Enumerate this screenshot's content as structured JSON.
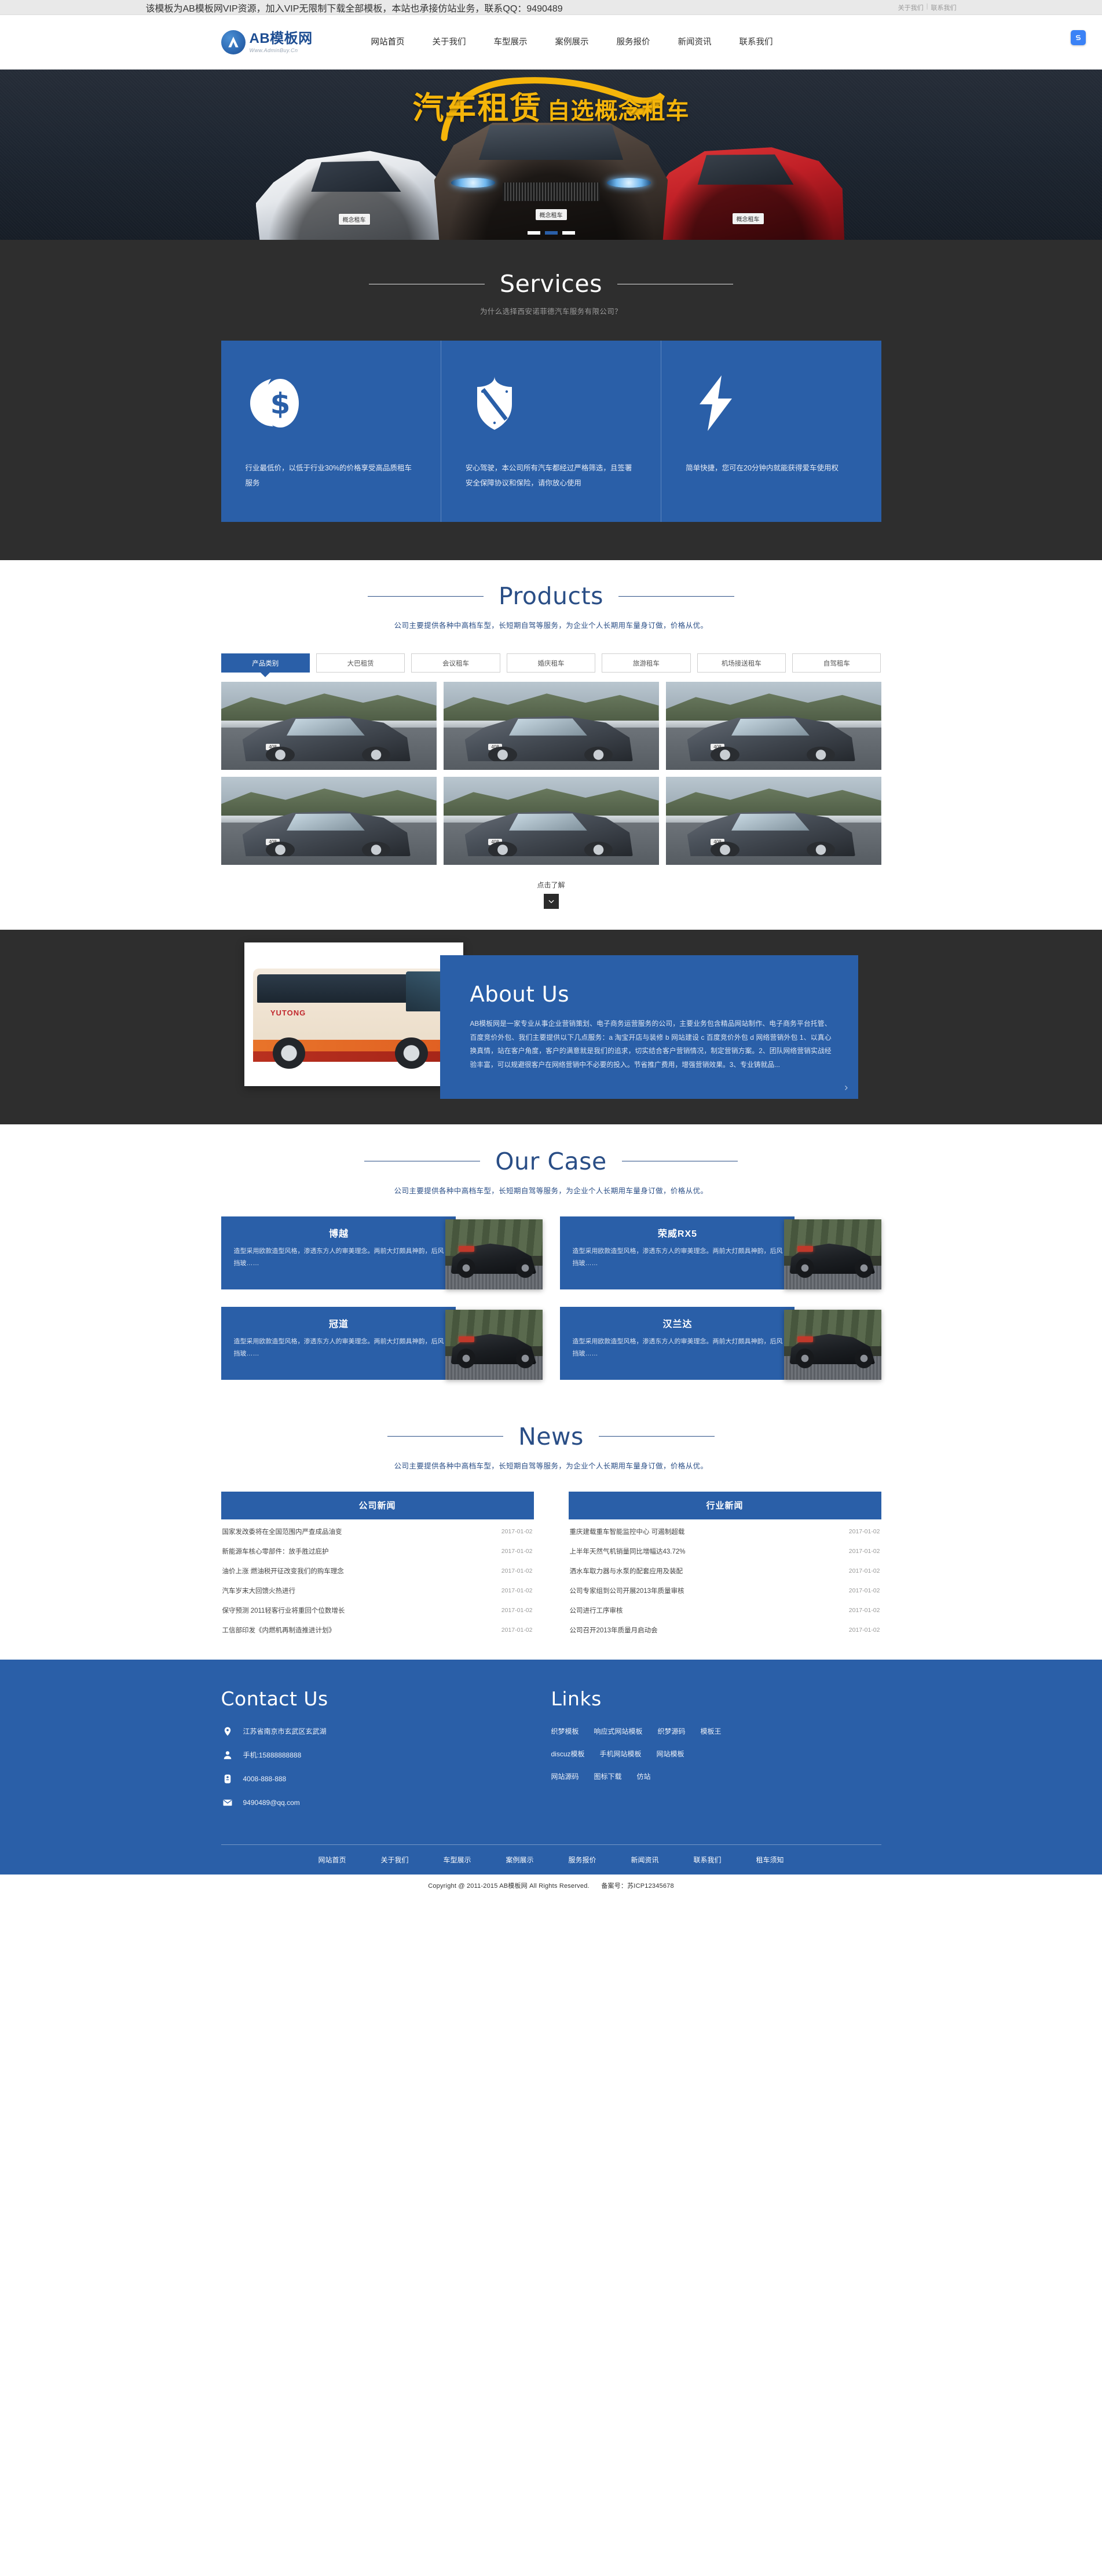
{
  "topbar": {
    "notice": "该模板为AB模板网VIP资源，加入VIP无限制下载全部模板，本站也承接仿站业务，联系QQ：9490489",
    "link_about": "关于我们",
    "separator": "|",
    "link_contact": "联系我们"
  },
  "header": {
    "logo_cn": "AB模板网",
    "logo_url": "Www.AdminBuy.Cn",
    "nav": [
      {
        "label": "网站首页"
      },
      {
        "label": "关于我们"
      },
      {
        "label": "车型展示"
      },
      {
        "label": "案例展示"
      },
      {
        "label": "服务报价"
      },
      {
        "label": "新闻资讯"
      },
      {
        "label": "联系我们"
      }
    ]
  },
  "hero": {
    "title_main": "汽车租赁",
    "title_sub": "自选概念租车",
    "plate": "概念租车",
    "slide_count": 3,
    "active_slide": 2
  },
  "services": {
    "title": "Services",
    "subtitle": "为什么选择西安诺菲德汽车服务有限公司？",
    "cards": [
      {
        "icon": "dollar-coin-icon",
        "text": "行业最低价，以低于行业30%的价格享受高品质租车服务"
      },
      {
        "icon": "shield-icon",
        "text": "安心驾驶，本公司所有汽车都经过严格筛选，且签署安全保障协议和保险，请你放心使用"
      },
      {
        "icon": "lightning-icon",
        "text": "简单快捷，您可在20分钟内就能获得爱车使用权"
      }
    ]
  },
  "products": {
    "title": "Products",
    "subtitle": "公司主要提供各种中高档车型，长短期自驾等服务，为企业个人长期用车量身订做，价格从优。",
    "tabs": [
      {
        "label": "产品类别",
        "active": true
      },
      {
        "label": "大巴租赁",
        "active": false
      },
      {
        "label": "会议租车",
        "active": false
      },
      {
        "label": "婚庆租车",
        "active": false
      },
      {
        "label": "旅游租车",
        "active": false
      },
      {
        "label": "机场接送租车",
        "active": false
      },
      {
        "label": "自驾租车",
        "active": false
      }
    ],
    "items": [
      {
        "plate": "408"
      },
      {
        "plate": "408"
      },
      {
        "plate": "408"
      },
      {
        "plate": "408"
      },
      {
        "plate": "408"
      },
      {
        "plate": "408"
      }
    ],
    "more_label": "点击了解",
    "more_icon": "chevron-down-icon"
  },
  "about": {
    "title": "About Us",
    "image_label": "YUTONG",
    "text": "AB模板网是一家专业从事企业营销策划、电子商务运营服务的公司，主要业务包含精品网站制作、电子商务平台托管、百度竞价外包、我们主要提供以下几点服务：a 淘宝开店与装修 b 网站建设 c 百度竞价外包 d 网络营销外包 1、以真心换真情，站在客户角度，客户的满意就是我们的追求，切实结合客户营销情况，制定营销方案。2、团队网络营销实战经验丰富，可以规避很客户在网络营销中不必要的投入。节省推广费用，增强营销效果。3、专业铸就品...",
    "next_icon": "chevron-right-icon"
  },
  "cases": {
    "title": "Our Case",
    "subtitle": "公司主要提供各种中高档车型，长短期自驾等服务，为企业个人长期用车量身订做，价格从优。",
    "items": [
      {
        "name": "博越",
        "desc": "造型采用欧款造型风格，渗透东方人的审美理念。两前大灯颇具神韵，后风挡玻……"
      },
      {
        "name": "荣威RX5",
        "desc": "造型采用欧款造型风格，渗透东方人的审美理念。两前大灯颇具神韵，后风挡玻……"
      },
      {
        "name": "冠道",
        "desc": "造型采用欧款造型风格，渗透东方人的审美理念。两前大灯颇具神韵，后风挡玻……"
      },
      {
        "name": "汉兰达",
        "desc": "造型采用欧款造型风格，渗透东方人的审美理念。两前大灯颇具神韵，后风挡玻……"
      }
    ]
  },
  "news": {
    "title": "News",
    "subtitle": "公司主要提供各种中高档车型，长短期自驾等服务，为企业个人长期用车量身订做，价格从优。",
    "columns": [
      {
        "heading": "公司新闻",
        "items": [
          {
            "title": "国家发改委将在全国范围内严查成品油变",
            "date": "2017-01-02"
          },
          {
            "title": "新能源车核心零部件：放手胜过庇护",
            "date": "2017-01-02"
          },
          {
            "title": "油价上涨 燃油税开征改变我们的购车理念",
            "date": "2017-01-02"
          },
          {
            "title": "汽车岁末大回馈火热进行",
            "date": "2017-01-02"
          },
          {
            "title": "保守预测 2011轻客行业将重回个位数增长",
            "date": "2017-01-02"
          },
          {
            "title": "工信部印发《内燃机再制造推进计划》",
            "date": "2017-01-02"
          }
        ]
      },
      {
        "heading": "行业新闻",
        "items": [
          {
            "title": "重庆建载重车智能监控中心 可遏制超载",
            "date": "2017-01-02"
          },
          {
            "title": "上半年天然气机销量同比增幅达43.72%",
            "date": "2017-01-02"
          },
          {
            "title": "洒水车取力器与水泵的配套应用及装配",
            "date": "2017-01-02"
          },
          {
            "title": "公司专家组到公司开展2013年质量审核",
            "date": "2017-01-02"
          },
          {
            "title": "公司进行工序审核",
            "date": "2017-01-02"
          },
          {
            "title": "公司召开2013年质量月启动会",
            "date": "2017-01-02"
          }
        ]
      }
    ]
  },
  "footer": {
    "contact_title": "Contact Us",
    "contact_items": [
      {
        "icon": "location-pin-icon",
        "value": "江苏省南京市玄武区玄武湖"
      },
      {
        "icon": "person-icon",
        "value": "手机:15888888888"
      },
      {
        "icon": "telephone-icon",
        "value": "4008-888-888"
      },
      {
        "icon": "envelope-icon",
        "value": "9490489@qq.com"
      }
    ],
    "links_title": "Links",
    "links_rows": [
      [
        "织梦模板",
        "响应式网站模板",
        "织梦源码",
        "模板王"
      ],
      [
        "discuz模板",
        "手机网站模板",
        "网站模板"
      ],
      [
        "网站源码",
        "图标下载",
        "仿站"
      ]
    ],
    "nav": [
      {
        "label": "网站首页"
      },
      {
        "label": "关于我们"
      },
      {
        "label": "车型展示"
      },
      {
        "label": "案例展示"
      },
      {
        "label": "服务报价"
      },
      {
        "label": "新闻资讯"
      },
      {
        "label": "联系我们"
      },
      {
        "label": "租车须知"
      }
    ],
    "copyright": "Copyright @ 2011-2015 AB模板网 All Rights Reserved.",
    "icp": "备案号：苏ICP12345678"
  },
  "colors": {
    "brand_blue": "#2a5fa8",
    "deep_blue": "#2a4e86",
    "dark_panel": "#2e2e2e",
    "hero_gold": "#f5b50a"
  }
}
